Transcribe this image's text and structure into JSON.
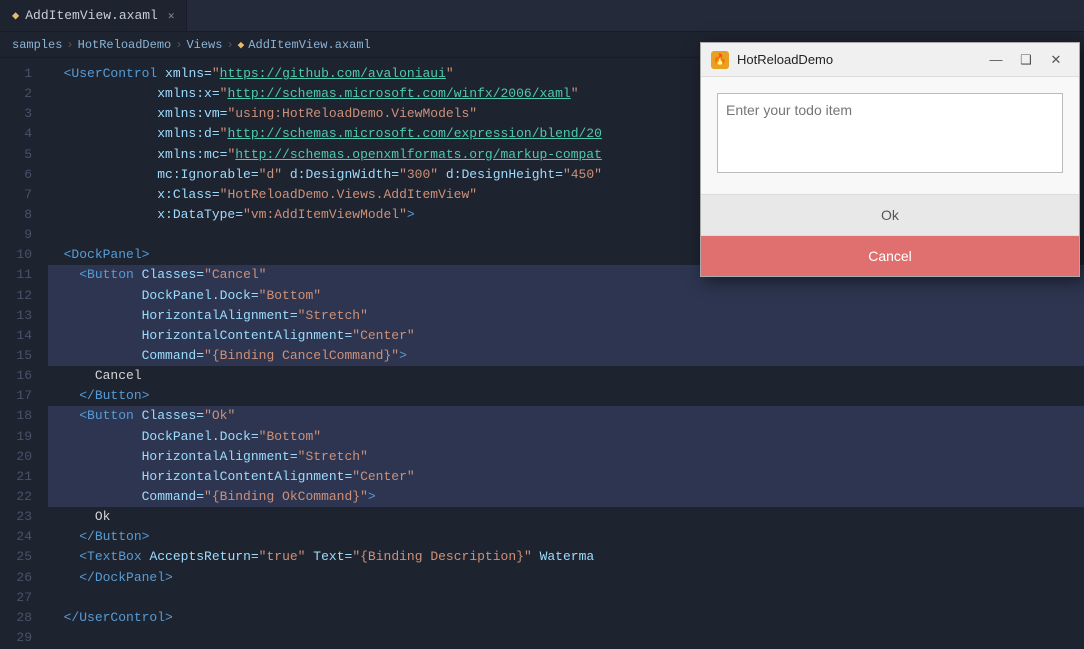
{
  "tab": {
    "icon": "◆",
    "label": "AddItemView.axaml",
    "close": "✕"
  },
  "breadcrumb": {
    "items": [
      "samples",
      "HotReloadDemo",
      "Views",
      "AddItemView.axaml"
    ],
    "separators": [
      ">",
      ">",
      ">"
    ]
  },
  "lines": {
    "numbers": [
      "1",
      "2",
      "3",
      "4",
      "5",
      "6",
      "7",
      "8",
      "9",
      "10",
      "11",
      "12",
      "13",
      "14",
      "15",
      "16",
      "17",
      "18",
      "19",
      "20",
      "21",
      "22",
      "23",
      "24",
      "25",
      "26",
      "27",
      "28",
      "29"
    ]
  },
  "modal": {
    "title": "HotReloadDemo",
    "title_icon": "🔥",
    "placeholder": "Enter your todo item",
    "minimize": "—",
    "restore": "❑",
    "close": "✕",
    "ok_label": "Ok",
    "cancel_label": "Cancel"
  },
  "colors": {
    "ok_bg": "#e8e8e8",
    "cancel_bg": "#e07070"
  }
}
